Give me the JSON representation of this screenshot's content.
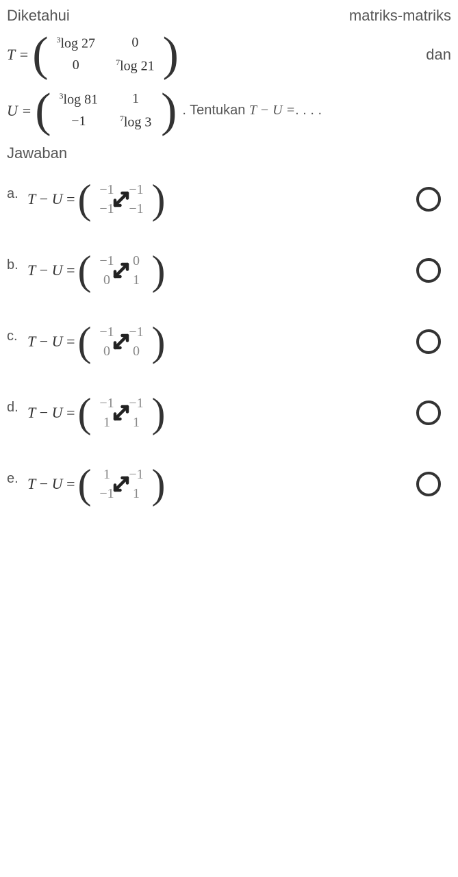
{
  "header": {
    "diketahui": "Diketahui",
    "matriks": "matriks-matriks"
  },
  "matrix_T": {
    "label": "T =",
    "cells": [
      "³log 27",
      "0",
      "0",
      "⁷log 21"
    ],
    "dan": "dan"
  },
  "matrix_U": {
    "label": "U =",
    "cells": [
      "³log 81",
      "1",
      "−1",
      "⁷log 3"
    ],
    "tentukan_prefix": ". Tentukan ",
    "tentukan_math": "T − U =",
    "tentukan_suffix": ". . . ."
  },
  "jawaban_title": "Jawaban",
  "options": [
    {
      "letter": "a.",
      "label_var1": "T",
      "label_minus": " − ",
      "label_var2": "U",
      "label_eq": " =",
      "cells": [
        "−1",
        "−1",
        "−1",
        "−1"
      ]
    },
    {
      "letter": "b.",
      "label_var1": "T",
      "label_minus": " − ",
      "label_var2": "U",
      "label_eq": " =",
      "cells": [
        "−1",
        "0",
        "0",
        "1"
      ]
    },
    {
      "letter": "c.",
      "label_var1": "T",
      "label_minus": " − ",
      "label_var2": "U",
      "label_eq": " =",
      "cells": [
        "−1",
        "−1",
        "0",
        "0"
      ]
    },
    {
      "letter": "d.",
      "label_var1": "T",
      "label_minus": " − ",
      "label_var2": "U",
      "label_eq": " =",
      "cells": [
        "−1",
        "−1",
        "1",
        "1"
      ]
    },
    {
      "letter": "e.",
      "label_var1": "T",
      "label_minus": " − ",
      "label_var2": "U",
      "label_eq": " =",
      "cells": [
        "1",
        "−1",
        "−1",
        "1"
      ]
    }
  ]
}
